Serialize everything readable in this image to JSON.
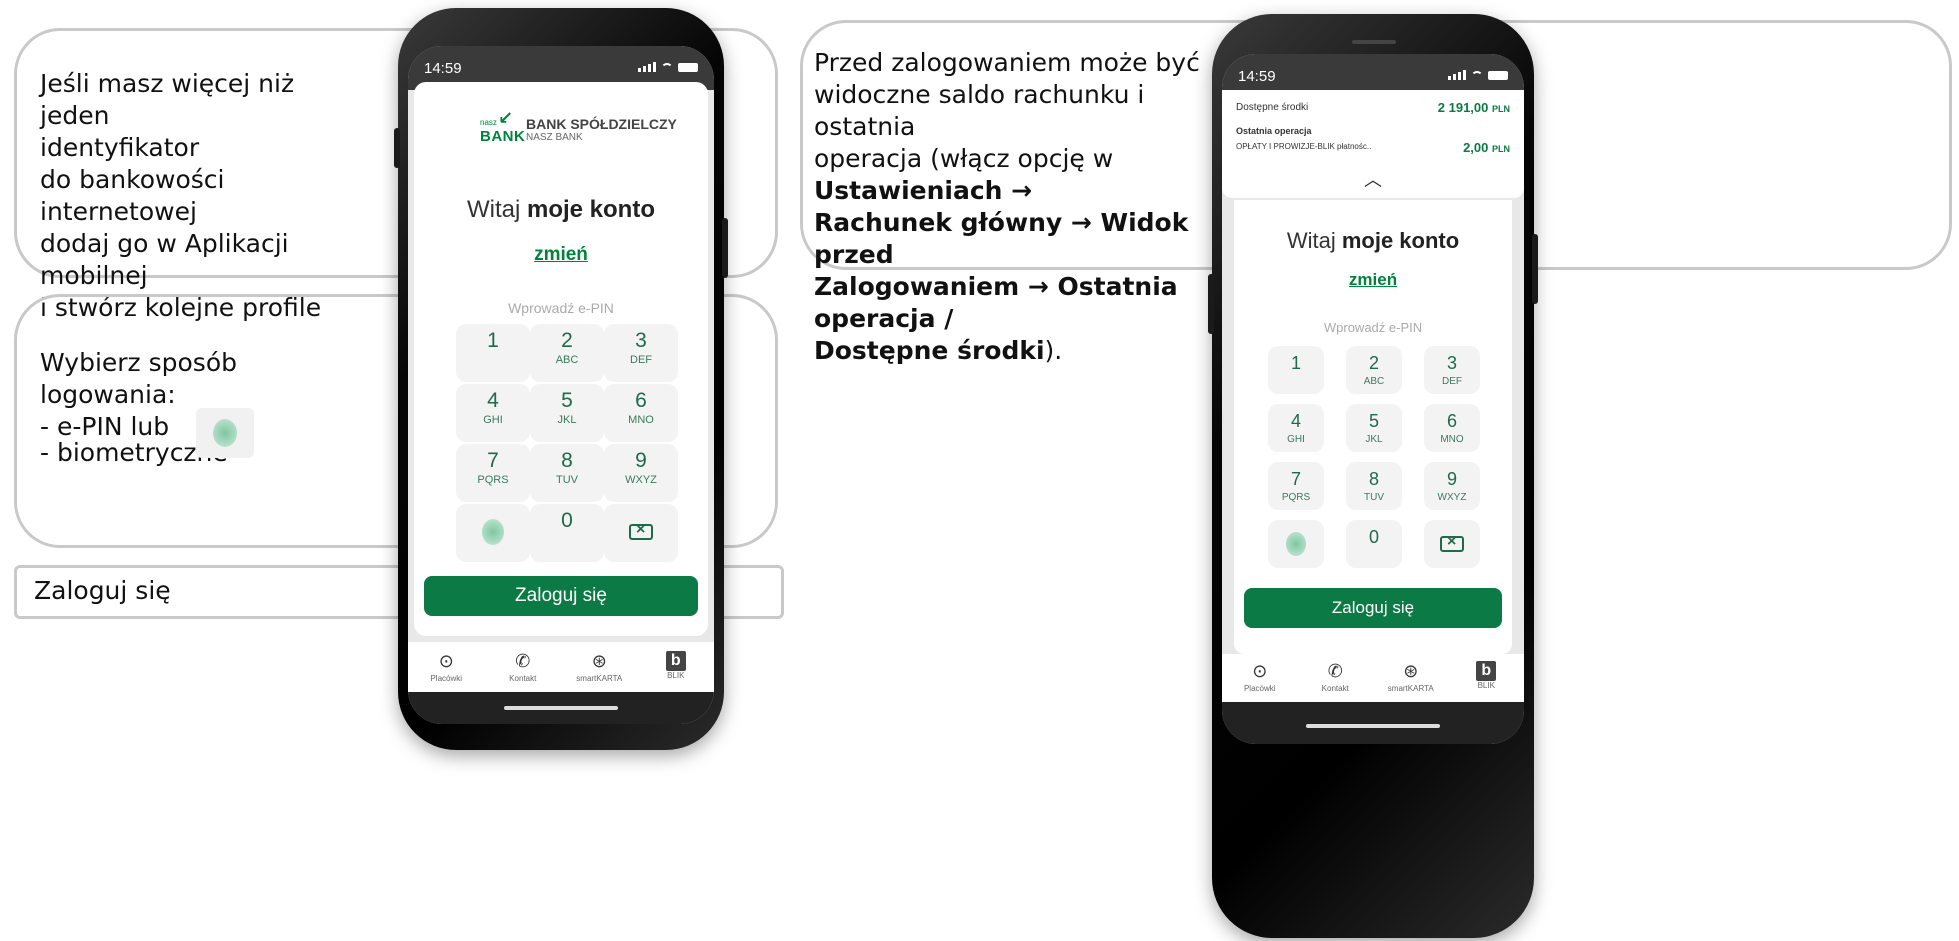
{
  "callouts": {
    "identifier": {
      "lines": [
        "Jeśli masz więcej niż jeden",
        "identyfikator",
        "do bankowości internetowej",
        "dodaj go w Aplikacji mobilnej",
        "i stwórz kolejne profile"
      ]
    },
    "login_method": {
      "title": "Wybierz sposób logowania:",
      "option_pin": "- e-PIN lub",
      "option_bio": "- biometryczne"
    },
    "login": {
      "text": "Zaloguj się"
    },
    "preview": {
      "t1": "Przed zalogowaniem może być",
      "t2": "widoczne saldo rachunku i ostatnia",
      "t3": "operacja (włącz opcję w ",
      "b1": "Ustawieniach →",
      "b2": "Rachunek główny → Widok przed",
      "b3": "Zalogowaniem → Ostatnia operacja /",
      "b4": "Dostępne środki",
      "t4": ")."
    }
  },
  "phone_left": {
    "time": "14:59",
    "logo": {
      "small": "nasz",
      "mark": "BANK",
      "name": "BANK SPÓŁDZIELCZY",
      "sub": "NASZ BANK"
    },
    "welcome_prefix": "Witaj ",
    "welcome_name": "moje konto",
    "change_link": "zmień",
    "epin_label": "Wprowadź e-PIN",
    "keys": [
      {
        "d": "1",
        "l": ""
      },
      {
        "d": "2",
        "l": "ABC"
      },
      {
        "d": "3",
        "l": "DEF"
      },
      {
        "d": "4",
        "l": "GHI"
      },
      {
        "d": "5",
        "l": "JKL"
      },
      {
        "d": "6",
        "l": "MNO"
      },
      {
        "d": "7",
        "l": "PQRS"
      },
      {
        "d": "8",
        "l": "TUV"
      },
      {
        "d": "9",
        "l": "WXYZ"
      },
      {
        "d": "0",
        "l": ""
      }
    ],
    "login_button": "Zaloguj się",
    "nav": [
      "Placówki",
      "Kontakt",
      "smartKARTA",
      "BLIK"
    ]
  },
  "phone_right": {
    "time": "14:59",
    "available_label": "Dostępne środki",
    "available_value": "2 191,00",
    "currency": "PLN",
    "last_op_label": "Ostatnia operacja",
    "last_op_desc": "OPŁATY I PROWIZJE-BLIK płatnośc..",
    "last_op_value": "2,00",
    "welcome_prefix": "Witaj ",
    "welcome_name": "moje konto",
    "change_link": "zmień",
    "epin_label": "Wprowadź e-PIN",
    "login_button": "Zaloguj się",
    "nav": [
      "Placówki",
      "Kontakt",
      "smartKARTA",
      "BLIK"
    ]
  },
  "icons": {
    "fingerprint": "fingerprint-icon",
    "backspace": "backspace-icon",
    "location": "location-pin-icon",
    "phone": "phone-icon",
    "card": "smartkarta-icon",
    "blik": "blik-icon"
  },
  "colors": {
    "brand_green": "#0b7a45",
    "callout_border": "#c9c9c9"
  }
}
